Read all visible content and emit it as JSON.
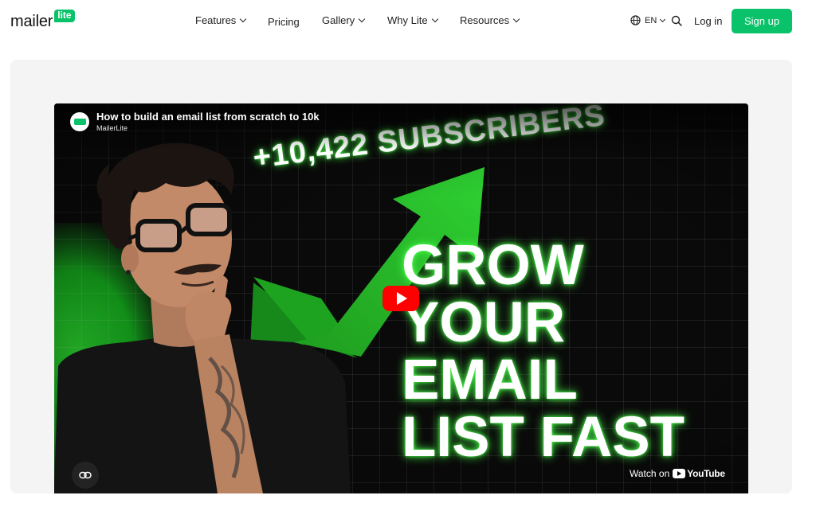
{
  "brand": {
    "word": "mailer",
    "badge": "lite"
  },
  "nav": {
    "items": [
      {
        "label": "Features",
        "has_dropdown": true
      },
      {
        "label": "Pricing",
        "has_dropdown": false
      },
      {
        "label": "Gallery",
        "has_dropdown": true
      },
      {
        "label": "Why Lite",
        "has_dropdown": true
      },
      {
        "label": "Resources",
        "has_dropdown": true
      }
    ]
  },
  "header_tools": {
    "language": "EN",
    "language_icon": "globe-icon",
    "search_icon": "search-icon",
    "login_label": "Log in",
    "signup_label": "Sign up"
  },
  "video": {
    "title": "How to build an email list from scratch to 10k",
    "channel": "MailerLite",
    "thumbnail": {
      "subscribers_text": "+10,422 SUBSCRIBERS",
      "headline_lines": [
        "GROW",
        "YOUR",
        "EMAIL",
        "LIST FAST"
      ]
    },
    "watch_on_label": "Watch on",
    "youtube_label": "YouTube",
    "play_icon": "play-icon",
    "copy_link_icon": "link-icon"
  },
  "colors": {
    "brand_green": "#09c269",
    "panel_bg": "#f4f4f4",
    "thumbnail_green": "#2bd12e",
    "youtube_red": "#ff0000"
  }
}
